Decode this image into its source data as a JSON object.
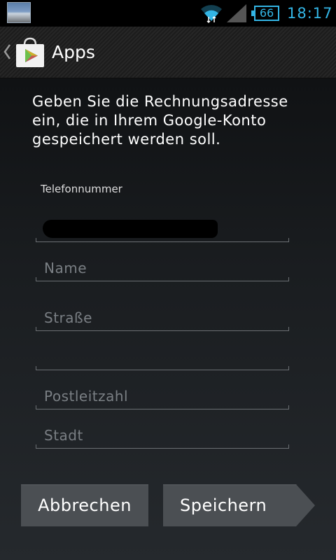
{
  "statusbar": {
    "battery_level": "66",
    "time": "18:17",
    "accent_color": "#33b5e5"
  },
  "actionbar": {
    "title": "Apps",
    "icon": "play-store-bag-icon"
  },
  "form": {
    "intro": "Geben Sie die Rechnungsadresse ein, die in Ihrem Google-Konto gespeichert werden soll.",
    "phone_label": "Telefonnummer",
    "phone_value_redacted": true,
    "name_placeholder": "Name",
    "street_placeholder": "Straße",
    "street2_placeholder": "",
    "postal_placeholder": "Postleitzahl",
    "city_placeholder": "Stadt"
  },
  "buttons": {
    "cancel": "Abbrechen",
    "save": "Speichern"
  }
}
